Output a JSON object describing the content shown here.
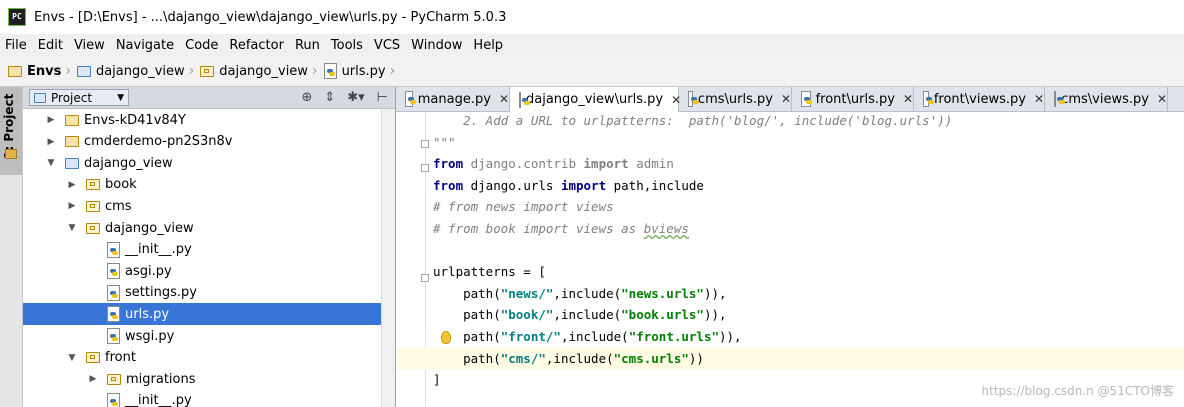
{
  "window": {
    "title": "Envs - [D:\\Envs] - ...\\dajango_view\\dajango_view\\urls.py - PyCharm 5.0.3"
  },
  "menu": [
    "File",
    "Edit",
    "View",
    "Navigate",
    "Code",
    "Refactor",
    "Run",
    "Tools",
    "VCS",
    "Window",
    "Help"
  ],
  "breadcrumb": [
    "Envs",
    "dajango_view",
    "dajango_view",
    "urls.py"
  ],
  "side_tool_window": {
    "label": "1: Project"
  },
  "project_panel": {
    "selector": "Project",
    "tree": [
      {
        "label": "Envs-kD41v84Y",
        "depth": 1,
        "expanded": false,
        "icon": "folder-icon"
      },
      {
        "label": "cmderdemo-pn2S3n8v",
        "depth": 1,
        "expanded": false,
        "icon": "folder-icon"
      },
      {
        "label": "dajango_view",
        "depth": 1,
        "expanded": true,
        "icon": "project-folder-icon"
      },
      {
        "label": "book",
        "depth": 2,
        "expanded": false,
        "icon": "package-icon"
      },
      {
        "label": "cms",
        "depth": 2,
        "expanded": false,
        "icon": "package-icon"
      },
      {
        "label": "dajango_view",
        "depth": 2,
        "expanded": true,
        "icon": "package-icon"
      },
      {
        "label": "__init__.py",
        "depth": 3,
        "icon": "python-file-icon"
      },
      {
        "label": "asgi.py",
        "depth": 3,
        "icon": "python-file-icon"
      },
      {
        "label": "settings.py",
        "depth": 3,
        "icon": "python-file-icon"
      },
      {
        "label": "urls.py",
        "depth": 3,
        "icon": "python-file-icon",
        "selected": true
      },
      {
        "label": "wsgi.py",
        "depth": 3,
        "icon": "python-file-icon"
      },
      {
        "label": "front",
        "depth": 2,
        "expanded": true,
        "icon": "package-icon"
      },
      {
        "label": "migrations",
        "depth": 3,
        "expanded": false,
        "icon": "package-icon"
      },
      {
        "label": "__init__.py",
        "depth": 3,
        "icon": "python-file-icon"
      }
    ]
  },
  "editor_tabs": [
    {
      "label": "manage.py",
      "active": false
    },
    {
      "label": "dajango_view\\urls.py",
      "active": true
    },
    {
      "label": "cms\\urls.py",
      "active": false
    },
    {
      "label": "front\\urls.py",
      "active": false
    },
    {
      "label": "front\\views.py",
      "active": false
    },
    {
      "label": "cms\\views.py",
      "active": false
    }
  ],
  "code_lines": [
    "    2. Add a URL to urlpatterns:  path('blog/', include('blog.urls'))",
    "\"\"\"",
    "from django.contrib import admin",
    "from django.urls import path,include",
    "# from news import views",
    "# from book import views as bviews",
    "",
    "urlpatterns = [",
    "    path(\"news/\",include(\"news.urls\")),",
    "    path(\"book/\",include(\"book.urls\")),",
    "    path(\"front/\",include(\"front.urls\")),",
    "    path(\"cms/\",include(\"cms.urls\"))",
    "]"
  ],
  "watermark": "https://blog.csdn.n @51CTO博客"
}
